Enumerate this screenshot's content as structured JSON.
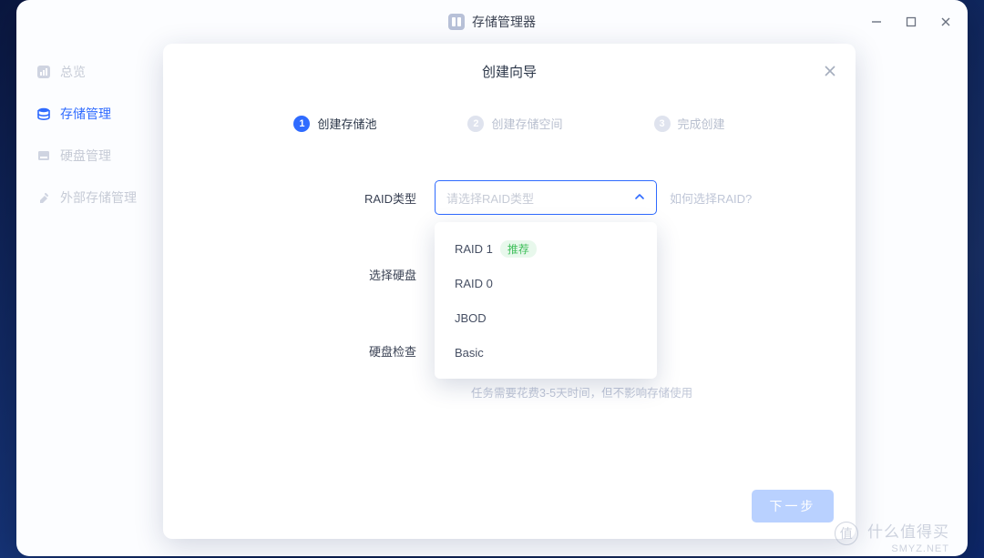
{
  "window": {
    "title": "存储管理器"
  },
  "sidebar": {
    "items": [
      {
        "label": "总览"
      },
      {
        "label": "存储管理"
      },
      {
        "label": "硬盘管理"
      },
      {
        "label": "外部存储管理"
      }
    ],
    "active_index": 1
  },
  "modal": {
    "title": "创建向导",
    "steps": [
      {
        "num": "1",
        "label": "创建存储池"
      },
      {
        "num": "2",
        "label": "创建存储空间"
      },
      {
        "num": "3",
        "label": "完成创建"
      }
    ],
    "active_step": 0,
    "form": {
      "raid_label": "RAID类型",
      "raid_placeholder": "请选择RAID类型",
      "raid_hint": "如何选择RAID?",
      "options": [
        {
          "label": "RAID 1",
          "badge": "推荐"
        },
        {
          "label": "RAID 0"
        },
        {
          "label": "JBOD"
        },
        {
          "label": "Basic"
        }
      ],
      "disk_label": "选择硬盘",
      "check_label": "硬盘检查",
      "check_note": "任务需要花费3-5天时间，但不影响存储使用"
    },
    "footer": {
      "next": "下一步"
    }
  },
  "watermark": {
    "badge": "值",
    "text": "什么值得买",
    "sub": "SMYZ.NET"
  }
}
